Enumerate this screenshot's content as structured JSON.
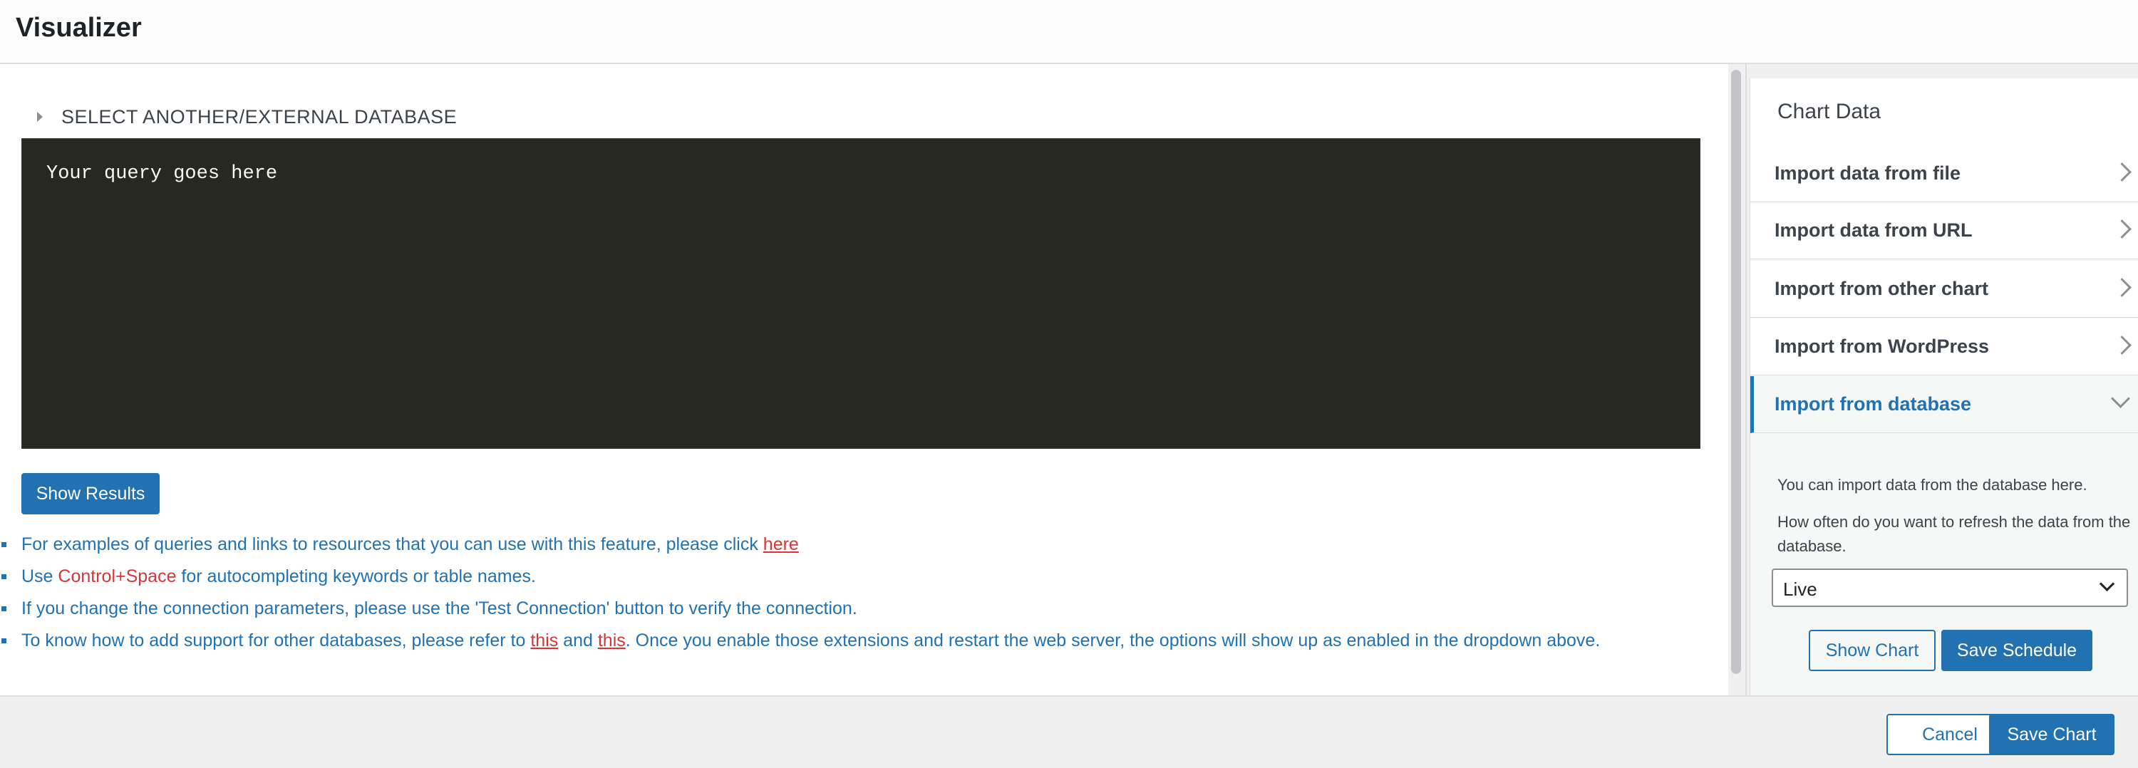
{
  "header": {
    "title": "Visualizer"
  },
  "main": {
    "db_toggle_label": "SELECT ANOTHER/EXTERNAL DATABASE",
    "editor_placeholder": "Your query goes here",
    "show_results_label": "Show Results",
    "tips": {
      "tip1_text": "For examples of queries and links to resources that you can use with this feature, please click ",
      "tip1_link": "here",
      "tip2_prefix": "Use ",
      "tip2_keyword": "Control+Space",
      "tip2_suffix": " for autocompleting keywords or table names.",
      "tip3_text": "If you change the connection parameters, please use the 'Test Connection' button to verify the connection.",
      "tip4_prefix": "To know how to add support for other databases, please refer to ",
      "tip4_link1": "this",
      "tip4_and": " and ",
      "tip4_link2": "this",
      "tip4_suffix": ". Once you enable those extensions and restart the web server, the options will show up as enabled in the dropdown above."
    }
  },
  "sidebar": {
    "title": "Chart Data",
    "items": [
      {
        "label": "Import data from file"
      },
      {
        "label": "Import data from URL"
      },
      {
        "label": "Import from other chart"
      },
      {
        "label": "Import from WordPress"
      },
      {
        "label": "Import from database"
      }
    ],
    "db_panel": {
      "description": "You can import data from the database here.",
      "refresh_prompt": "How often do you want to refresh the data from the database.",
      "refresh_value": "Live",
      "show_chart_label": "Show Chart",
      "save_schedule_label": "Save Schedule"
    }
  },
  "footer": {
    "cancel_label": "Cancel",
    "save_chart_label": "Save Chart"
  },
  "colors": {
    "accent": "#2271b1",
    "editor_bg": "#272822",
    "link": "#d63638"
  }
}
